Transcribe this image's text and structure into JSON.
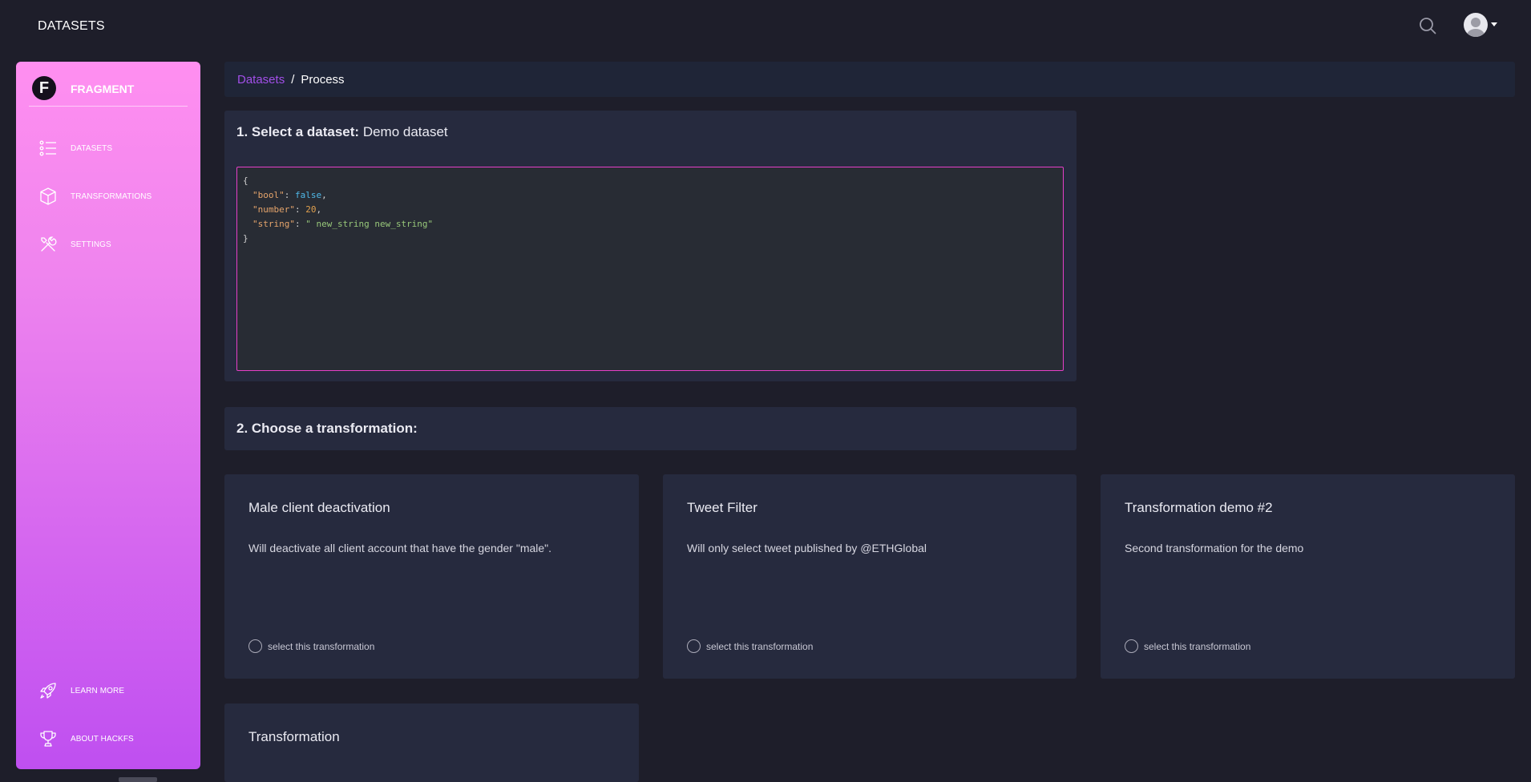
{
  "topbar": {
    "title": "DATASETS",
    "search_icon": "search-icon",
    "avatar_icon": "user-avatar"
  },
  "sidebar": {
    "brand": {
      "logo_letter": "F",
      "name": "FRAGMENT"
    },
    "items": [
      {
        "label": "DATASETS",
        "icon": "list-icon"
      },
      {
        "label": "TRANSFORMATIONS",
        "icon": "cube-icon"
      },
      {
        "label": "SETTINGS",
        "icon": "tools-icon"
      }
    ],
    "bottom_items": [
      {
        "label": "LEARN MORE",
        "icon": "rocket-icon"
      },
      {
        "label": "ABOUT HACKFS",
        "icon": "trophy-icon"
      }
    ]
  },
  "breadcrumb": {
    "link": "Datasets",
    "separator": "/",
    "current": "Process"
  },
  "step1": {
    "heading": "1. Select a dataset:",
    "dataset_name": "Demo dataset",
    "json_lines": {
      "open": "{",
      "bool_key": "\"bool\"",
      "bool_val": "false",
      "number_key": "\"number\"",
      "number_val": "20",
      "string_key": "\"string\"",
      "string_val": "\" new_string new_string\"",
      "close": "}"
    }
  },
  "step2": {
    "heading": "2. Choose a transformation:"
  },
  "transformations": [
    {
      "title": "Male client deactivation",
      "description": "Will deactivate all client account that have the gender \"male\".",
      "select_label": "select this transformation"
    },
    {
      "title": "Tweet Filter",
      "description": "Will only select tweet published by @ETHGlobal",
      "select_label": "select this transformation"
    },
    {
      "title": "Transformation demo #2",
      "description": "Second transformation for the demo",
      "select_label": "select this transformation"
    },
    {
      "title": "Transformation",
      "description": "",
      "select_label": ""
    }
  ],
  "colors": {
    "background": "#1e1e2a",
    "panel": "#262a3e",
    "accent_link": "#a24fe8",
    "code_border": "#e63fc9",
    "sidebar_top": "#ff8ff0",
    "sidebar_bottom": "#bf4ff0"
  }
}
